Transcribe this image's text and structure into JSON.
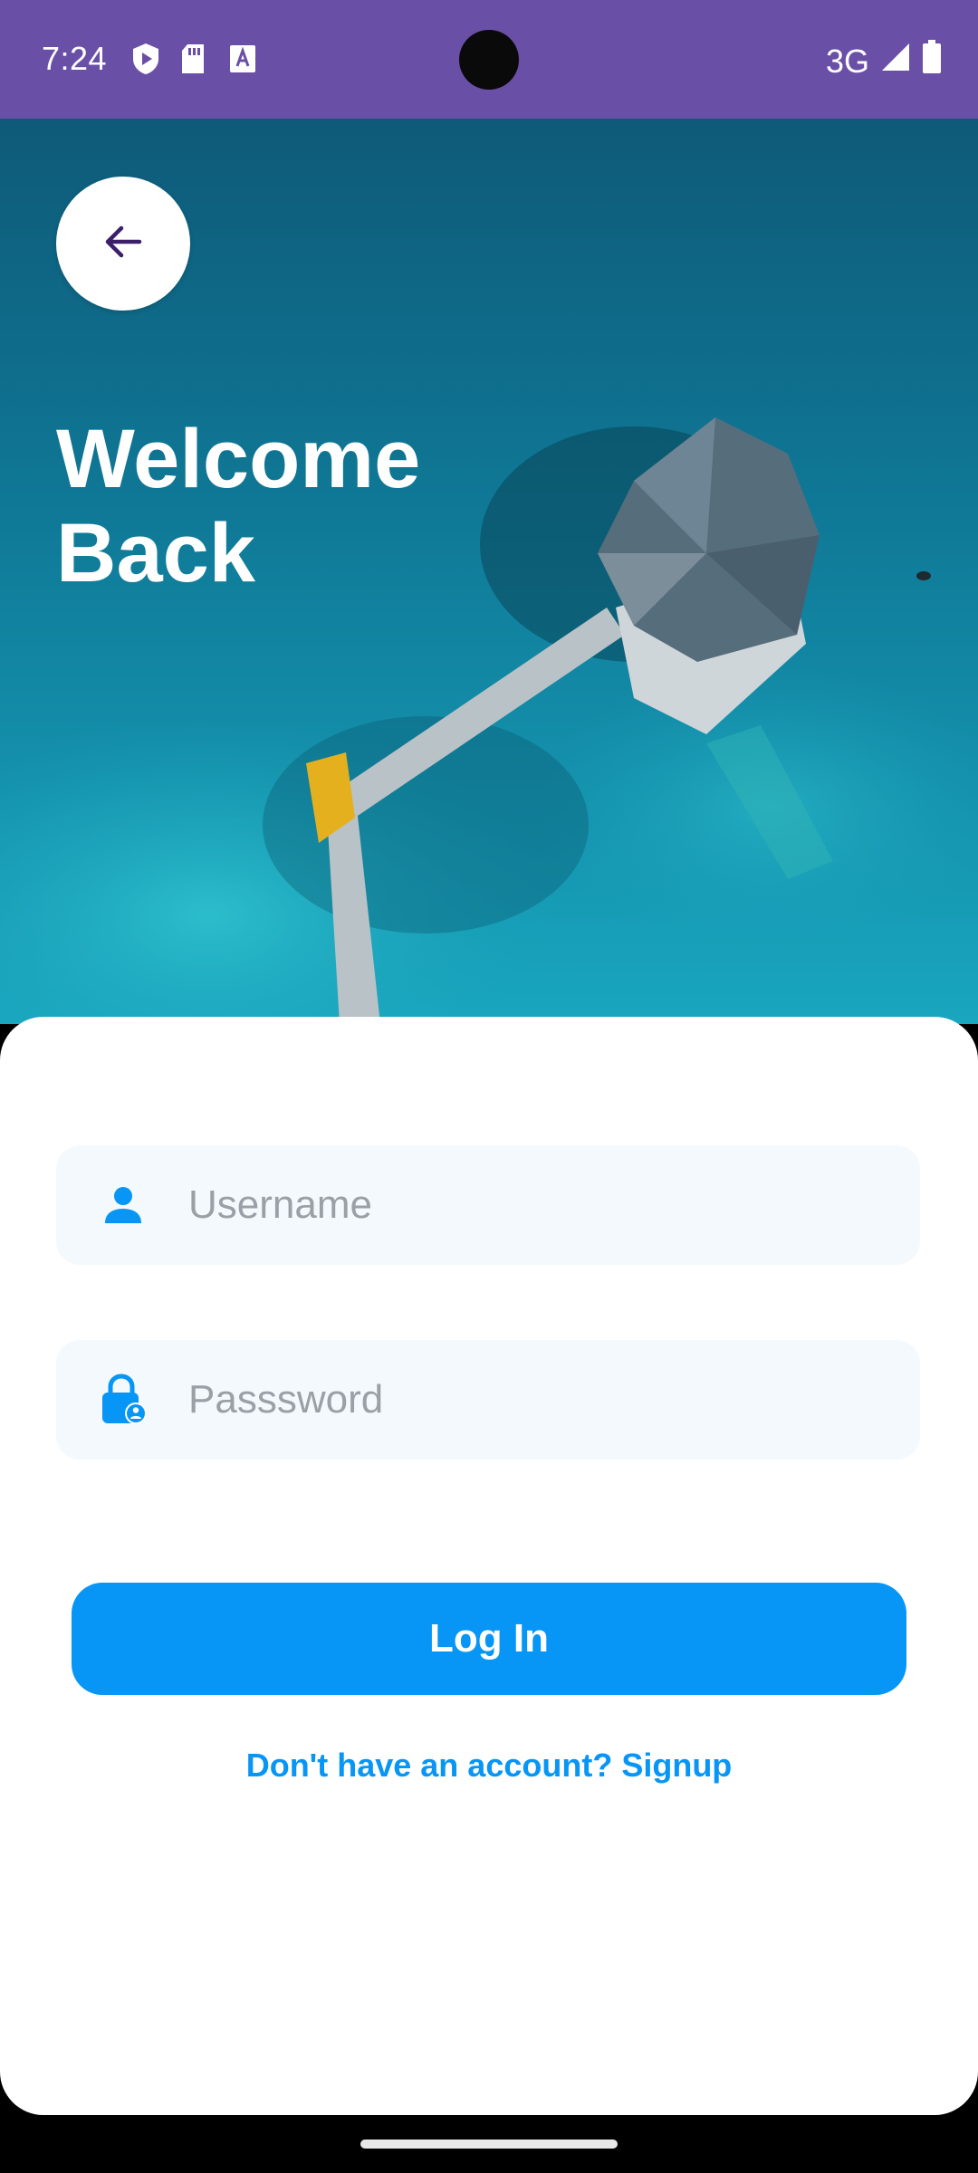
{
  "status_bar": {
    "time": "7:24",
    "network": "3G",
    "icons": [
      "shield-play-icon",
      "sd-card-icon",
      "font-icon",
      "signal-icon",
      "battery-icon"
    ]
  },
  "hero": {
    "title_line1": "Welcome",
    "title_line2": "Back",
    "back_icon": "arrow-left-icon"
  },
  "form": {
    "username": {
      "placeholder": "Username",
      "value": "",
      "icon": "person-icon"
    },
    "password": {
      "placeholder": "Passsword",
      "value": "",
      "icon": "lock-person-icon"
    },
    "login_label": "Log In",
    "signup_text": "Don't have an account? Signup"
  },
  "colors": {
    "status_bar": "#6a4fa6",
    "accent": "#0796f5",
    "field_bg": "#f4f9fd",
    "back_arrow": "#3b1f6b"
  }
}
